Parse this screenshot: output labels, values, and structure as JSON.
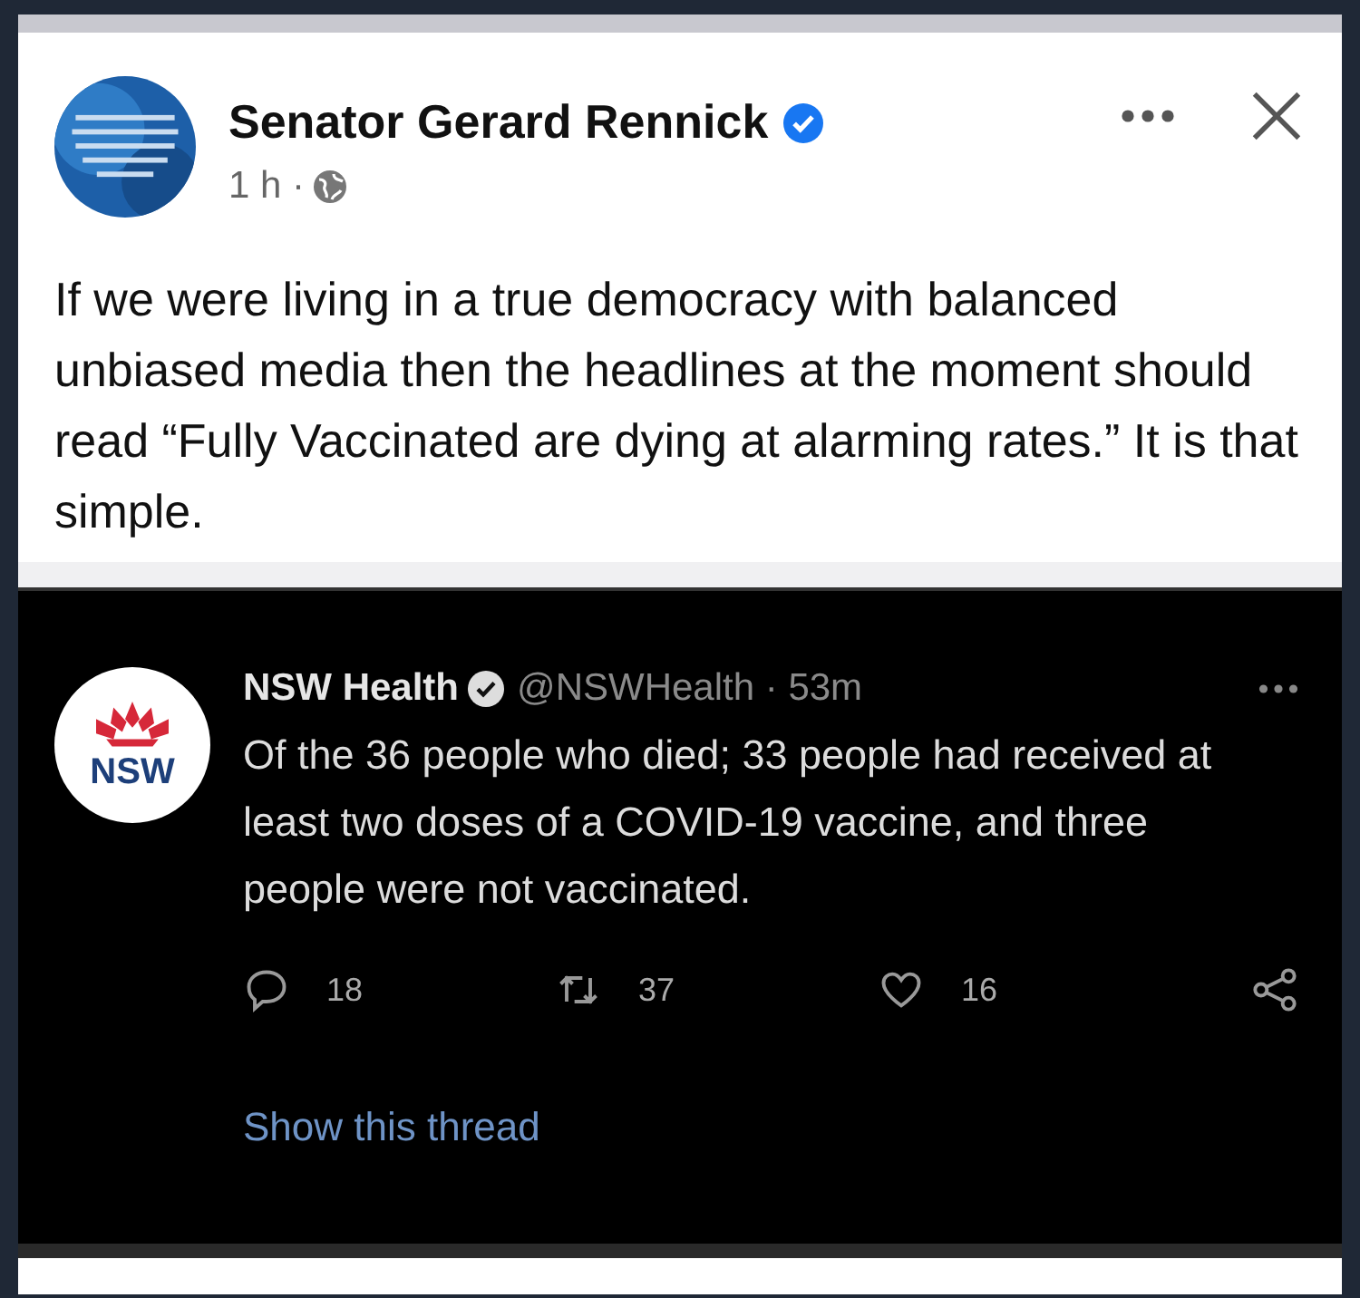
{
  "post": {
    "author": "Senator Gerard Rennick",
    "verified": true,
    "time": "1 h ·",
    "text": "If we were living in a true democracy with balanced unbiased media then the headlines at the moment should read “Fully Vaccinated are dying at alarming rates.” It is that simple."
  },
  "tweet": {
    "name": "NSW Health",
    "verified": true,
    "handle": "@NSWHealth · 53m",
    "logo_text": "NSW",
    "text": "Of the 36 people who died; 33 people had received at least two doses of a COVID-19 vaccine, and three people were not vaccinated.",
    "actions": [
      {
        "kind": "reply",
        "count": "18"
      },
      {
        "kind": "retweet",
        "count": "37"
      },
      {
        "kind": "like",
        "count": "16"
      },
      {
        "kind": "share"
      }
    ],
    "show_thread": "Show this thread"
  }
}
